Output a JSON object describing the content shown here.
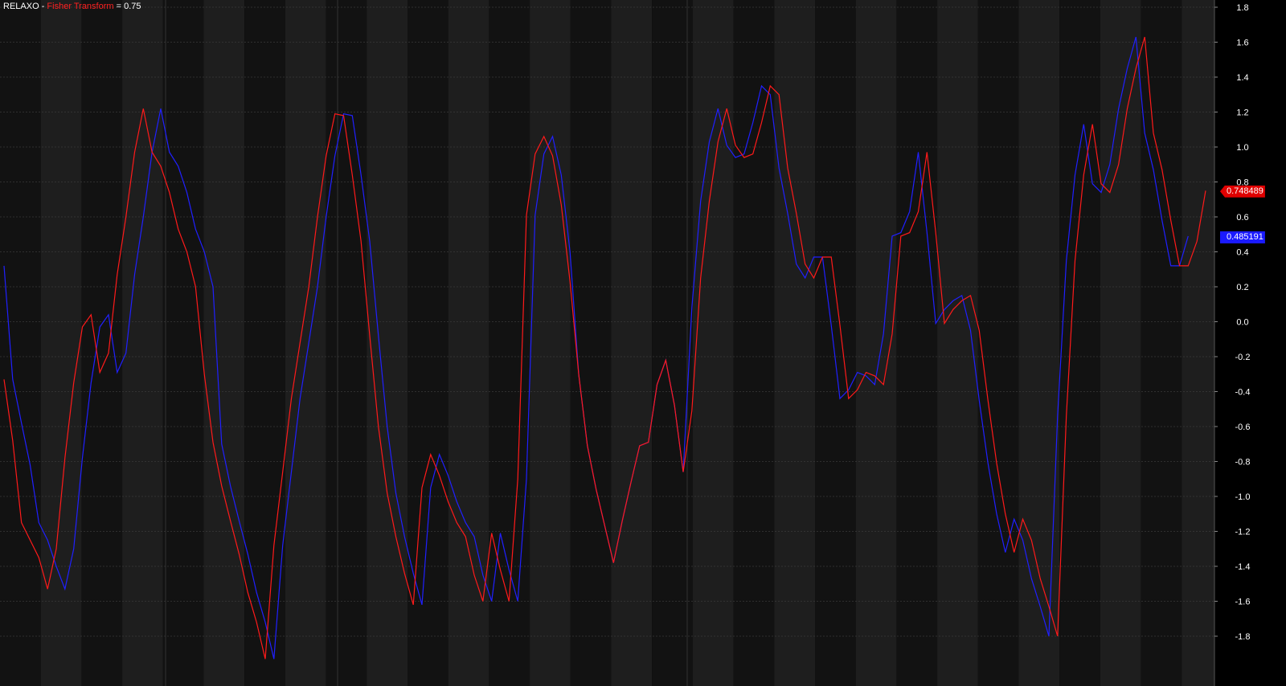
{
  "header": {
    "symbol": "RELAXO",
    "separator": " - ",
    "indicator": "Fisher Transform",
    "equals": " = ",
    "value": "0.75"
  },
  "tags": {
    "fisher_value": "0.748489",
    "trigger_value": "0.485191"
  },
  "chart_data": {
    "type": "line",
    "title": "RELAXO - Fisher Transform = 0.75",
    "ylim": [
      -1.9,
      1.8
    ],
    "ticks": [
      "1.8",
      "1.6",
      "1.4",
      "1.2",
      "1.0",
      "0.8",
      "0.6",
      "0.4",
      "0.2",
      "0.0",
      "-0.2",
      "-0.4",
      "-0.6",
      "-0.8",
      "-1.0",
      "-1.2",
      "-1.4",
      "-1.6",
      "-1.8"
    ],
    "tick_values": [
      1.8,
      1.6,
      1.4,
      1.2,
      1.0,
      0.8,
      0.6,
      0.4,
      0.2,
      0.0,
      -0.2,
      -0.4,
      -0.6,
      -0.8,
      -1.0,
      -1.2,
      -1.4,
      -1.6,
      -1.8
    ],
    "grid": true,
    "colors": {
      "background": "#000000",
      "band_dark": "#121212",
      "band_light": "#1e1e1e",
      "grid": "#3a3a3a",
      "fisher": "#ff1a1a",
      "trigger": "#2020ff",
      "axis_text": "#ffffff"
    },
    "series": [
      {
        "color": "#ff1a1a",
        "values": [
          -0.33,
          -0.68,
          -1.15,
          -1.25,
          -1.35,
          -1.53,
          -1.3,
          -0.78,
          -0.35,
          -0.03,
          0.04,
          -0.29,
          -0.18,
          0.27,
          0.6,
          0.97,
          1.22,
          0.97,
          0.89,
          0.74,
          0.53,
          0.4,
          0.2,
          -0.3,
          -0.69,
          -0.94,
          -1.14,
          -1.33,
          -1.55,
          -1.72,
          -1.93,
          -1.28,
          -0.86,
          -0.44,
          -0.12,
          0.2,
          0.6,
          0.95,
          1.19,
          1.18,
          0.84,
          0.46,
          -0.08,
          -0.6,
          -0.98,
          -1.23,
          -1.44,
          -1.62,
          -0.95,
          -0.76,
          -0.88,
          -1.03,
          -1.15,
          -1.23,
          -1.45,
          -1.6,
          -1.21,
          -1.42,
          -1.6,
          -0.9,
          0.61,
          0.96,
          1.06,
          0.95,
          0.67,
          0.23,
          -0.3,
          -0.71,
          -0.96,
          -1.17,
          -1.38,
          -1.14,
          -0.92,
          -0.71,
          -0.69,
          -0.36,
          -0.22,
          -0.48,
          -0.86,
          -0.51,
          0.25,
          0.69,
          1.03,
          1.22,
          1.01,
          0.94,
          0.96,
          1.14,
          1.35,
          1.3,
          0.88,
          0.62,
          0.33,
          0.25,
          0.37,
          0.37,
          -0.02,
          -0.44,
          -0.39,
          -0.29,
          -0.31,
          -0.36,
          -0.07,
          0.49,
          0.51,
          0.63,
          0.97,
          0.51,
          -0.01,
          0.07,
          0.12,
          0.15,
          -0.05,
          -0.45,
          -0.81,
          -1.1,
          -1.32,
          -1.13,
          -1.25,
          -1.47,
          -1.63,
          -1.8,
          -0.54,
          0.35,
          0.84,
          1.13,
          0.79,
          0.74,
          0.9,
          1.22,
          1.45,
          1.63,
          1.08,
          0.87,
          0.58,
          0.32,
          0.32,
          0.46,
          0.75
        ]
      },
      {
        "color": "#2020ff",
        "values": [
          0.32,
          -0.33,
          -0.58,
          -0.82,
          -1.15,
          -1.25,
          -1.4,
          -1.53,
          -1.3,
          -0.78,
          -0.35,
          -0.03,
          0.04,
          -0.29,
          -0.18,
          0.27,
          0.6,
          0.97,
          1.22,
          0.97,
          0.89,
          0.74,
          0.53,
          0.4,
          0.2,
          -0.7,
          -0.94,
          -1.14,
          -1.33,
          -1.55,
          -1.72,
          -1.93,
          -1.28,
          -0.86,
          -0.44,
          -0.12,
          0.2,
          0.6,
          0.95,
          1.19,
          1.18,
          0.84,
          0.46,
          -0.08,
          -0.6,
          -0.98,
          -1.23,
          -1.44,
          -1.62,
          -0.95,
          -0.76,
          -0.88,
          -1.03,
          -1.15,
          -1.23,
          -1.45,
          -1.6,
          -1.21,
          -1.42,
          -1.6,
          -0.9,
          0.61,
          0.96,
          1.06,
          0.84,
          0.4,
          -0.3,
          -0.71,
          -0.96,
          -1.17,
          -1.38,
          -1.14,
          -0.92,
          -0.71,
          -0.69,
          -0.36,
          -0.22,
          -0.48,
          -0.86,
          0.08,
          0.69,
          1.03,
          1.22,
          1.01,
          0.94,
          0.96,
          1.14,
          1.35,
          1.3,
          0.88,
          0.62,
          0.33,
          0.25,
          0.37,
          0.37,
          -0.02,
          -0.44,
          -0.39,
          -0.29,
          -0.31,
          -0.36,
          -0.07,
          0.49,
          0.51,
          0.63,
          0.97,
          0.51,
          -0.01,
          0.07,
          0.12,
          0.15,
          -0.05,
          -0.45,
          -0.81,
          -1.1,
          -1.32,
          -1.13,
          -1.25,
          -1.47,
          -1.63,
          -1.8,
          -0.54,
          0.35,
          0.84,
          1.13,
          0.79,
          0.74,
          0.9,
          1.22,
          1.45,
          1.63,
          1.08,
          0.87,
          0.58,
          0.32,
          0.32,
          0.49
        ]
      }
    ]
  }
}
